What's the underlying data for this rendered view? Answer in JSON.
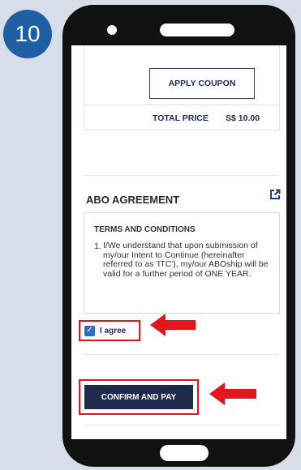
{
  "step": {
    "number": "10"
  },
  "order": {
    "apply_coupon_label": "APPLY COUPON",
    "total_label": "TOTAL PRICE",
    "total_value": "S$ 10.00"
  },
  "agreement": {
    "title": "ABO AGREEMENT",
    "external_icon": "external-link-icon",
    "terms_heading": "TERMS AND CONDITIONS",
    "terms_number": "1.",
    "terms_text": "I/We understand that upon submission of my/our Intent to Continue (hereinafter referred to as 'ITC'), my/our ABOship will be valid for a further period of ONE YEAR."
  },
  "consent": {
    "checked": true,
    "label": "I agree"
  },
  "actions": {
    "confirm_label": "CONFIRM AND PAY"
  },
  "colors": {
    "badge": "#1f5fa3",
    "highlight": "#e3161b",
    "confirm_bg": "#1f2b4d",
    "checkbox": "#2c6fb3"
  }
}
